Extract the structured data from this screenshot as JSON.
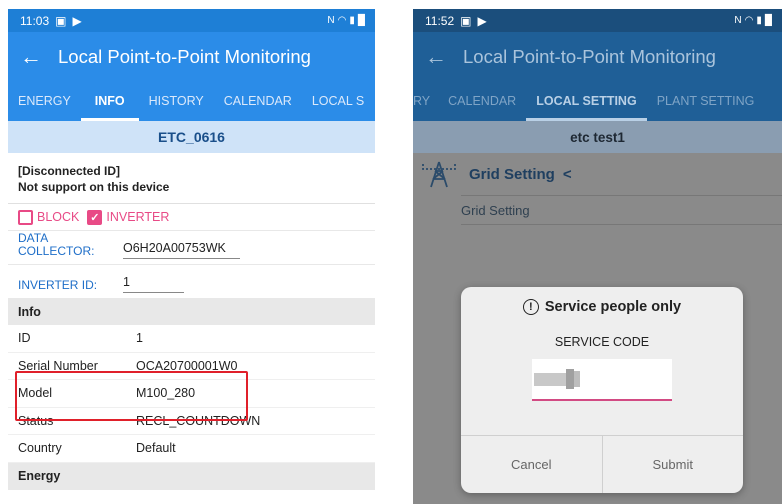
{
  "left": {
    "status": {
      "time": "11:03"
    },
    "app_title": "Local Point-to-Point Monitoring",
    "tabs": [
      "ENERGY",
      "INFO",
      "HISTORY",
      "CALENDAR",
      "LOCAL S"
    ],
    "active_tab": "INFO",
    "device_name": "ETC_0616",
    "disconnected": {
      "line1": "[Disconnected ID]",
      "line2": "Not support on this device"
    },
    "checkboxes": [
      {
        "label": "BLOCK",
        "checked": false
      },
      {
        "label": "INVERTER",
        "checked": true
      }
    ],
    "fields": [
      {
        "label": "DATA COLLECTOR:",
        "value": "O6H20A00753WK"
      },
      {
        "label": "INVERTER ID:",
        "value": "1"
      }
    ],
    "info_section": "Info",
    "info_rows": [
      {
        "key": "ID",
        "value": "1"
      },
      {
        "key": "Serial Number",
        "value": "OCA20700001W0"
      },
      {
        "key": "Model",
        "value": "M100_280"
      },
      {
        "key": "Status",
        "value": "RECL_COUNTDOWN"
      },
      {
        "key": "Country",
        "value": "Default"
      }
    ],
    "energy_section": "Energy"
  },
  "right": {
    "status": {
      "time": "11:52"
    },
    "app_title": "Local Point-to-Point Monitoring",
    "tabs": [
      "RY",
      "CALENDAR",
      "LOCAL SETTING",
      "PLANT SETTING"
    ],
    "active_tab": "LOCAL SETTING",
    "device_name": "etc test1",
    "grid_title": "Grid Setting",
    "grid_item": "Grid Setting",
    "dialog": {
      "title": "Service people only",
      "label": "SERVICE CODE",
      "cancel": "Cancel",
      "submit": "Submit"
    }
  },
  "colors": {
    "accent_blue": "#2b8ce8",
    "pink": "#e84a86",
    "highlight_red": "#e0202a"
  }
}
